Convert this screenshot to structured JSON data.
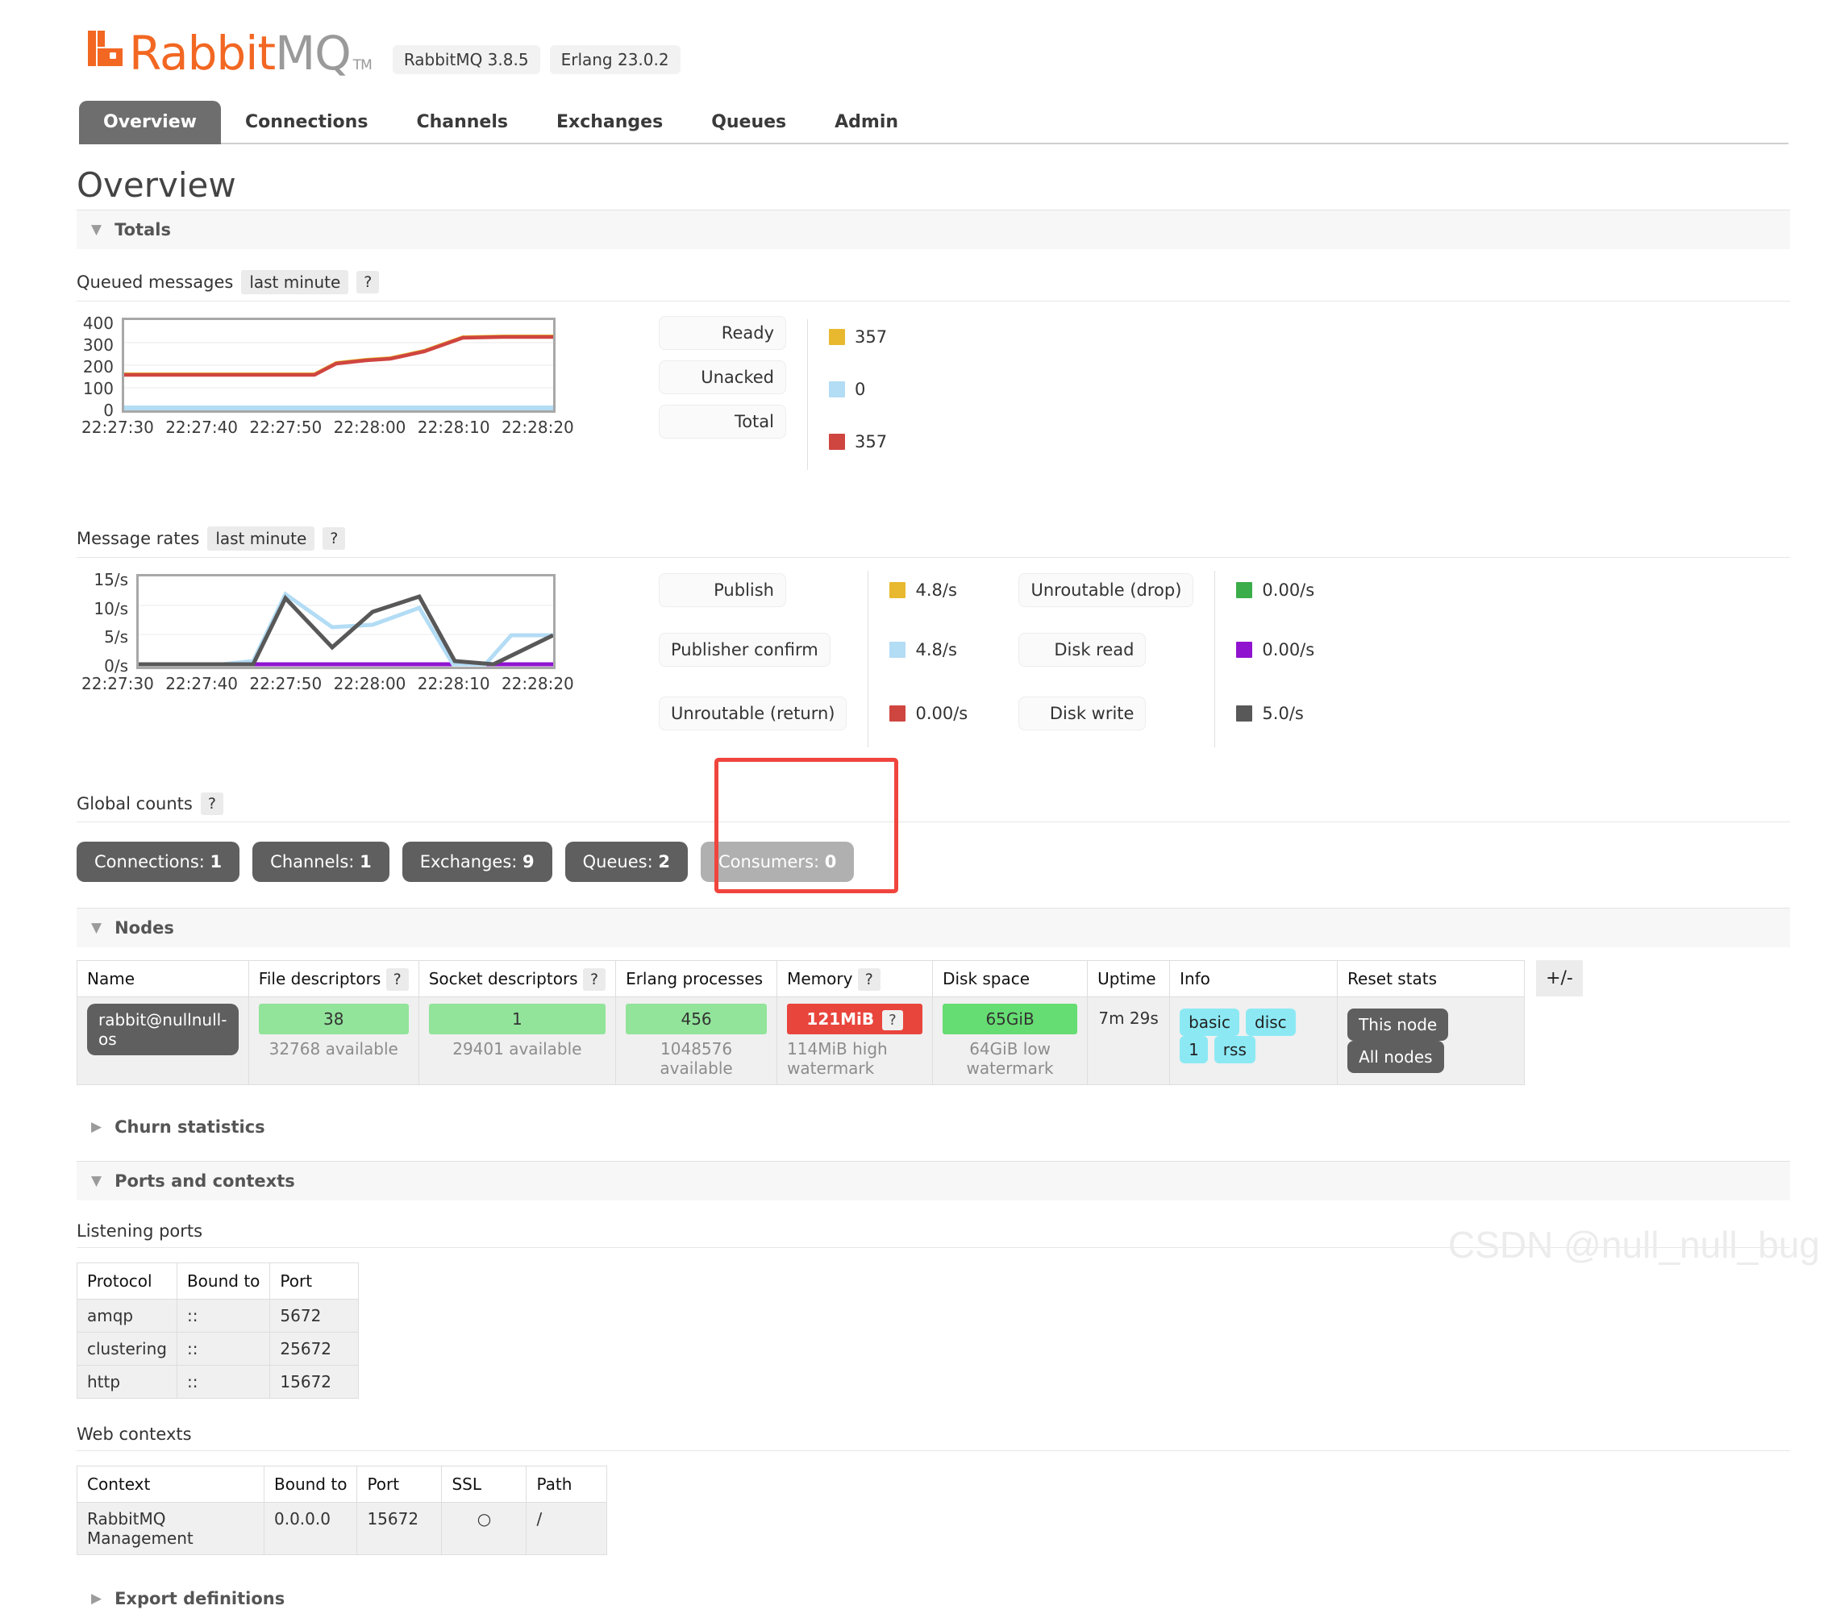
{
  "brand": {
    "name_part1": "Rabbit",
    "name_part2": "MQ",
    "tm": "TM",
    "version_badges": [
      "RabbitMQ 3.8.5",
      "Erlang 23.0.2"
    ],
    "accent_color": "#f26722"
  },
  "nav": {
    "tabs": [
      {
        "label": "Overview",
        "active": true
      },
      {
        "label": "Connections",
        "active": false
      },
      {
        "label": "Channels",
        "active": false
      },
      {
        "label": "Exchanges",
        "active": false
      },
      {
        "label": "Queues",
        "active": false
      },
      {
        "label": "Admin",
        "active": false
      }
    ]
  },
  "page": {
    "title": "Overview"
  },
  "sections": {
    "totals": {
      "label": "Totals",
      "expanded": true,
      "tri": "▼"
    },
    "nodes": {
      "label": "Nodes",
      "expanded": true,
      "tri": "▼"
    },
    "churn": {
      "label": "Churn statistics",
      "expanded": false,
      "tri": "▶"
    },
    "ports_contexts": {
      "label": "Ports and contexts",
      "expanded": true,
      "tri": "▼"
    },
    "export": {
      "label": "Export definitions",
      "expanded": false,
      "tri": "▶"
    }
  },
  "queued": {
    "heading": "Queued messages",
    "period": "last minute",
    "help": "?",
    "legend": [
      {
        "label": "Ready",
        "value": "357",
        "color": "#e8b92e"
      },
      {
        "label": "Unacked",
        "value": "0",
        "color": "#b3dcf5"
      },
      {
        "label": "Total",
        "value": "357",
        "color": "#cf4540"
      }
    ]
  },
  "rates": {
    "heading": "Message rates",
    "period": "last minute",
    "help": "?",
    "legend_left": [
      {
        "label": "Publish",
        "value": "4.8/s",
        "color": "#e8b92e"
      },
      {
        "label": "Publisher confirm",
        "value": "4.8/s",
        "color": "#b3dcf5"
      },
      {
        "label": "Unroutable (return)",
        "value": "0.00/s",
        "color": "#cf4540"
      }
    ],
    "legend_right": [
      {
        "label": "Unroutable (drop)",
        "value": "0.00/s",
        "color": "#3bad4a"
      },
      {
        "label": "Disk read",
        "value": "0.00/s",
        "color": "#9013cf"
      },
      {
        "label": "Disk write",
        "value": "5.0/s",
        "color": "#585858"
      }
    ]
  },
  "global_counts": {
    "heading": "Global counts",
    "help": "?",
    "buttons": [
      {
        "label": "Connections:",
        "value": "1",
        "muted": false
      },
      {
        "label": "Channels:",
        "value": "1",
        "muted": false
      },
      {
        "label": "Exchanges:",
        "value": "9",
        "muted": false
      },
      {
        "label": "Queues:",
        "value": "2",
        "muted": false
      },
      {
        "label": "Consumers:",
        "value": "0",
        "muted": true
      }
    ]
  },
  "nodes_table": {
    "headers": [
      {
        "label": "Name",
        "help": null
      },
      {
        "label": "File descriptors",
        "help": "?"
      },
      {
        "label": "Socket descriptors",
        "help": "?"
      },
      {
        "label": "Erlang processes",
        "help": null
      },
      {
        "label": "Memory",
        "help": "?"
      },
      {
        "label": "Disk space",
        "help": null
      },
      {
        "label": "Uptime",
        "help": null
      },
      {
        "label": "Info",
        "help": null
      },
      {
        "label": "Reset stats",
        "help": null
      }
    ],
    "row": {
      "name": "rabbit@nullnull-os",
      "file_descriptors": {
        "value": "38",
        "sub": "32768 available"
      },
      "socket_descriptors": {
        "value": "1",
        "sub": "29401 available"
      },
      "erlang_processes": {
        "value": "456",
        "sub": "1048576 available"
      },
      "memory": {
        "value": "121MiB",
        "badge": "?",
        "sub": "114MiB high watermark"
      },
      "disk_space": {
        "value": "65GiB",
        "sub": "64GiB low watermark"
      },
      "uptime": "7m 29s",
      "info": [
        "basic",
        "disc",
        "1",
        "rss"
      ],
      "reset_stats": [
        "This node",
        "All nodes"
      ]
    },
    "toggle_columns": "+/-"
  },
  "listening_ports": {
    "heading": "Listening ports",
    "headers": [
      "Protocol",
      "Bound to",
      "Port"
    ],
    "rows": [
      [
        "amqp",
        "::",
        "5672"
      ],
      [
        "clustering",
        "::",
        "25672"
      ],
      [
        "http",
        "::",
        "15672"
      ]
    ]
  },
  "web_contexts": {
    "heading": "Web contexts",
    "headers": [
      "Context",
      "Bound to",
      "Port",
      "SSL",
      "Path"
    ],
    "rows": [
      [
        "RabbitMQ Management",
        "0.0.0.0",
        "15672",
        "○",
        "/"
      ]
    ]
  },
  "watermark": {
    "text": "CSDN @null_null_bug"
  },
  "chart_data": [
    {
      "type": "line",
      "title": "Queued messages",
      "subtitle": "last minute",
      "xlabel": "",
      "ylabel": "",
      "x": [
        "22:27:30",
        "22:27:40",
        "22:27:50",
        "22:28:00",
        "22:28:10",
        "22:28:20"
      ],
      "xtick_labels": [
        "22:27:30",
        "22:27:40",
        "22:27:50",
        "22:28:00",
        "22:28:10",
        "22:28:20"
      ],
      "ytick_labels": [
        "0",
        "100",
        "200",
        "300",
        "400"
      ],
      "ylim": [
        0,
        400
      ],
      "grid": true,
      "legend_position": "right",
      "series": [
        {
          "name": "Total",
          "color": "#cf4540",
          "current": 357,
          "values": [
            160,
            160,
            160,
            160,
            160,
            160,
            160,
            160,
            160,
            210,
            222,
            228,
            250,
            285,
            330,
            334,
            336,
            337
          ]
        },
        {
          "name": "Ready",
          "color": "#e8b92e",
          "current": 357,
          "values": [
            160,
            160,
            160,
            160,
            160,
            160,
            160,
            160,
            160,
            210,
            222,
            228,
            250,
            285,
            330,
            334,
            336,
            337
          ]
        },
        {
          "name": "Unacked",
          "color": "#b3dcf5",
          "current": 0,
          "values": [
            0,
            0,
            0,
            0,
            0,
            0,
            0,
            0,
            0,
            0,
            0,
            0,
            0,
            0,
            0,
            0,
            0,
            0
          ]
        }
      ]
    },
    {
      "type": "line",
      "title": "Message rates",
      "subtitle": "last minute",
      "xlabel": "",
      "ylabel": "",
      "x": [
        "22:27:30",
        "22:27:40",
        "22:27:50",
        "22:28:00",
        "22:28:10",
        "22:28:20"
      ],
      "xtick_labels": [
        "22:27:30",
        "22:27:40",
        "22:27:50",
        "22:28:00",
        "22:28:10",
        "22:28:20"
      ],
      "ytick_labels": [
        "0/s",
        "5/s",
        "10/s",
        "15/s"
      ],
      "ylim": [
        0,
        15
      ],
      "grid": true,
      "legend_position": "right",
      "series": [
        {
          "name": "Publisher confirm",
          "color": "#b3dcf5",
          "current": "4.8/s",
          "values": [
            0,
            0,
            0,
            0,
            0.2,
            0.8,
            12.0,
            6.5,
            7.0,
            9.8,
            0.3,
            0.3,
            5.0,
            5.0
          ]
        },
        {
          "name": "Disk write",
          "color": "#585858",
          "current": "5.0/s",
          "values": [
            0,
            0,
            0,
            0,
            0,
            0,
            11.2,
            3.0,
            9.0,
            11.8,
            0.9,
            0.1,
            0.1,
            5.0
          ]
        },
        {
          "name": "Disk read",
          "color": "#9013cf",
          "current": "0.00/s",
          "values": [
            0,
            0,
            0,
            0,
            0,
            0,
            0,
            0,
            0,
            0,
            0,
            0,
            0,
            0
          ]
        },
        {
          "name": "Publish",
          "color": "#e8b92e",
          "current": "4.8/s",
          "values": [
            0,
            0,
            0,
            0,
            0,
            0,
            0,
            0,
            0,
            0,
            0,
            0,
            0,
            0
          ]
        },
        {
          "name": "Unroutable (return)",
          "color": "#cf4540",
          "current": "0.00/s",
          "values": [
            0,
            0,
            0,
            0,
            0,
            0,
            0,
            0,
            0,
            0,
            0,
            0,
            0,
            0
          ]
        },
        {
          "name": "Unroutable (drop)",
          "color": "#3bad4a",
          "current": "0.00/s",
          "values": [
            0,
            0,
            0,
            0,
            0,
            0,
            0,
            0,
            0,
            0,
            0,
            0,
            0,
            0
          ]
        }
      ]
    }
  ]
}
